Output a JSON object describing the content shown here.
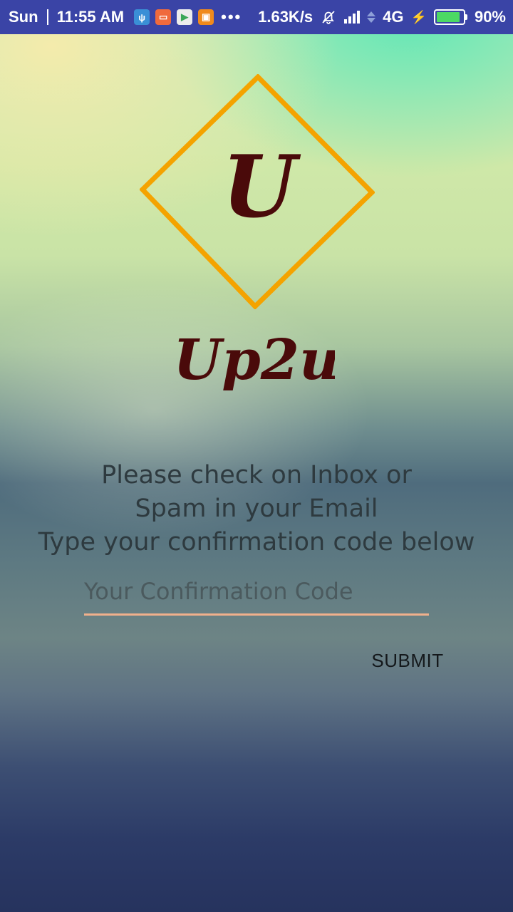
{
  "status_bar": {
    "day": "Sun",
    "time": "11:55 AM",
    "notification_icons": [
      "usb-icon",
      "mi-app-icon",
      "play-store-icon",
      "app-store-icon"
    ],
    "more": "•••",
    "net_speed": "1.63K/s",
    "network_type": "4G",
    "battery_percent": "90%",
    "battery_level": 0.9,
    "colors": {
      "bar": "#3a44a6",
      "battery_fill": "#4cd964"
    }
  },
  "logo": {
    "monogram": "U",
    "app_name": "Up2u",
    "colors": {
      "diamond": "#f4a300",
      "lettering": "#4a0a0a"
    }
  },
  "instructions": {
    "line1": "Please check on Inbox or",
    "line2": "Spam in your Email",
    "line3": "Type your confirmation code below"
  },
  "code_input": {
    "value": "",
    "placeholder": "Your Confirmation Code",
    "underline_color": "#f0b08c"
  },
  "submit_label": "SUBMIT"
}
